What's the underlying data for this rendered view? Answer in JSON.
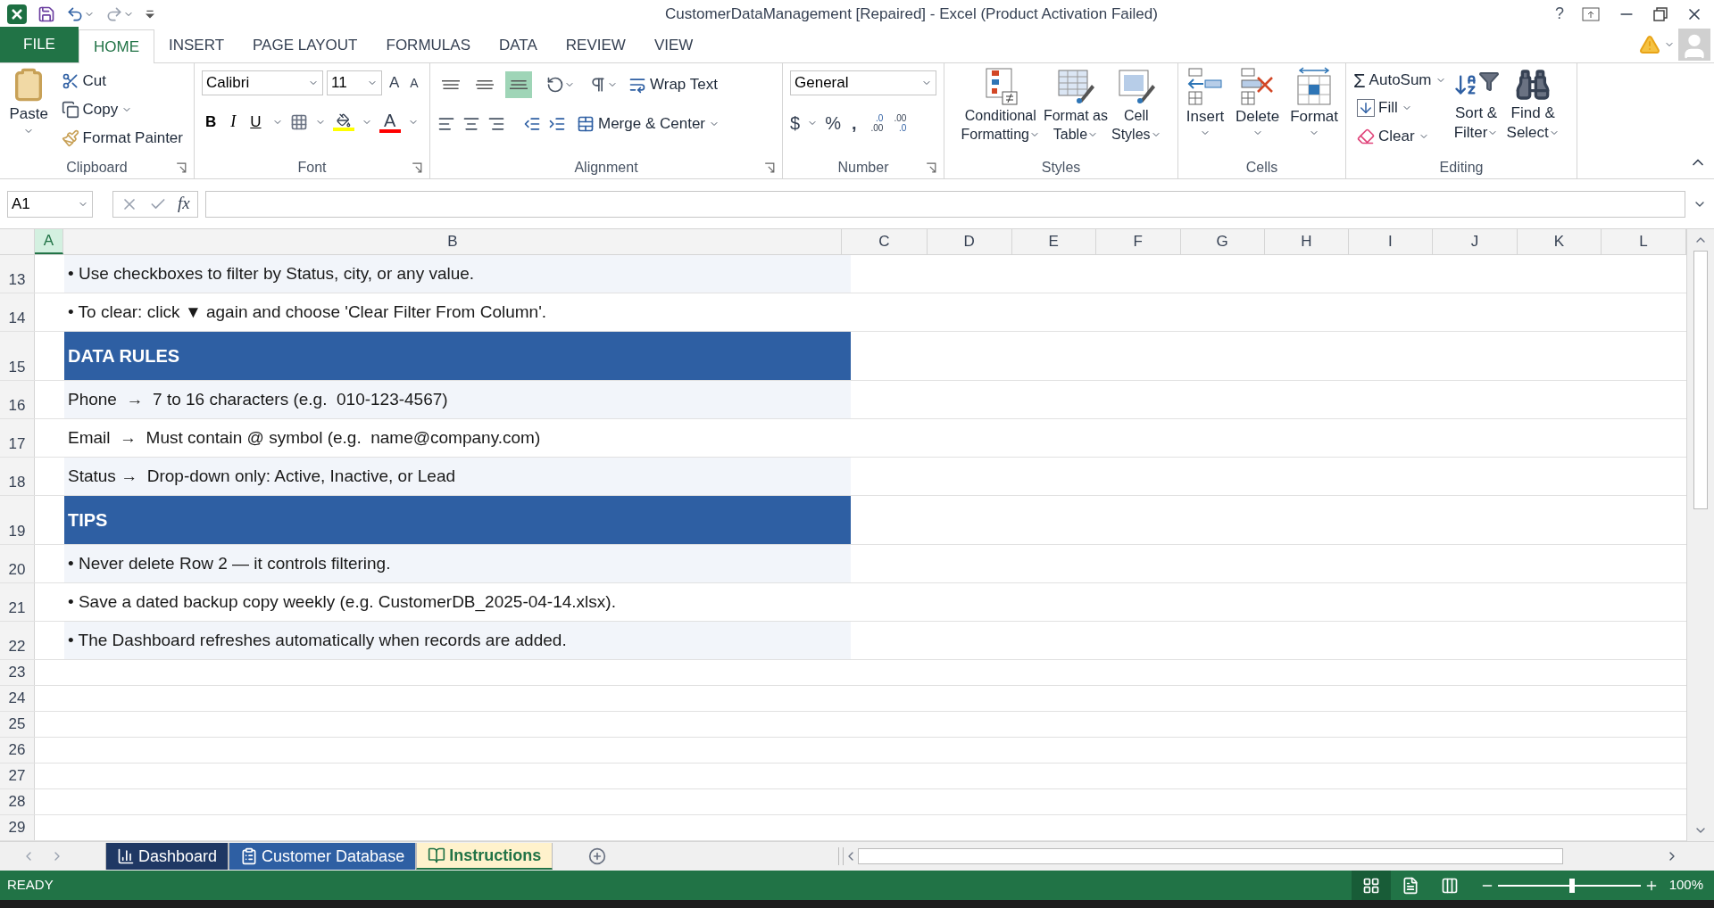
{
  "window": {
    "title": "CustomerDataManagement [Repaired] - Excel (Product Activation Failed)",
    "help": "?"
  },
  "ribbon_tabs": [
    {
      "label": "FILE",
      "kind": "file",
      "selected": false
    },
    {
      "label": "HOME",
      "kind": "tab",
      "selected": true
    },
    {
      "label": "INSERT",
      "kind": "tab",
      "selected": false
    },
    {
      "label": "PAGE LAYOUT",
      "kind": "tab",
      "selected": false
    },
    {
      "label": "FORMULAS",
      "kind": "tab",
      "selected": false
    },
    {
      "label": "DATA",
      "kind": "tab",
      "selected": false
    },
    {
      "label": "REVIEW",
      "kind": "tab",
      "selected": false
    },
    {
      "label": "VIEW",
      "kind": "tab",
      "selected": false
    }
  ],
  "clipboard": {
    "label": "Clipboard",
    "paste": "Paste",
    "cut": "Cut",
    "copy": "Copy",
    "format_painter": "Format Painter"
  },
  "font": {
    "label": "Font",
    "name": "Calibri",
    "size": "11",
    "grow": "A",
    "shrink": "A",
    "bold": "B",
    "italic": "I",
    "underline": "U",
    "font_color": "A"
  },
  "alignment": {
    "label": "Alignment",
    "wrap_text": "Wrap Text",
    "merge_center": "Merge & Center",
    "vertical": [
      {
        "kind": "top",
        "selected": false
      },
      {
        "kind": "middle",
        "selected": false
      },
      {
        "kind": "bottom",
        "selected": true
      }
    ]
  },
  "number": {
    "label": "Number",
    "format": "General",
    "currency": "$",
    "percent": "%",
    "comma": ",",
    "increase_decimal": [
      ".0",
      ".00"
    ],
    "decrease_decimal": [
      ".00",
      ".0"
    ]
  },
  "styles": {
    "label": "Styles",
    "buttons": [
      {
        "kind": "conditional",
        "lines": [
          "Conditional",
          "Formatting"
        ]
      },
      {
        "kind": "table",
        "lines": [
          "Format as",
          "Table"
        ]
      },
      {
        "kind": "cell",
        "lines": [
          "Cell",
          "Styles"
        ]
      }
    ]
  },
  "cells": {
    "label": "Cells",
    "buttons": [
      {
        "kind": "insert",
        "label": "Insert"
      },
      {
        "kind": "delete",
        "label": "Delete"
      },
      {
        "kind": "format",
        "label": "Format"
      }
    ]
  },
  "editing": {
    "label": "Editing",
    "autosum_glyph": "Σ",
    "autosum": "AutoSum",
    "fill": "Fill",
    "clear": "Clear",
    "sort_filter": [
      "Sort &",
      "Filter"
    ],
    "find_select": [
      "Find &",
      "Select"
    ]
  },
  "formula_bar": {
    "name_box": "A1",
    "fx": "fx"
  },
  "columns": [
    {
      "label": "A",
      "selected": true
    },
    {
      "label": "B",
      "selected": false
    },
    {
      "label": "C",
      "selected": false
    },
    {
      "label": "D",
      "selected": false
    },
    {
      "label": "E",
      "selected": false
    },
    {
      "label": "F",
      "selected": false
    },
    {
      "label": "G",
      "selected": false
    },
    {
      "label": "H",
      "selected": false
    },
    {
      "label": "I",
      "selected": false
    },
    {
      "label": "J",
      "selected": false
    },
    {
      "label": "K",
      "selected": false
    },
    {
      "label": "L",
      "selected": false
    }
  ],
  "rows": [
    {
      "number": "13",
      "kind": "text",
      "shaded": true,
      "text": "• Use checkboxes to filter by Status, city, or any value."
    },
    {
      "number": "14",
      "kind": "text",
      "shaded": false,
      "text": "• To clear: click ▼ again and choose 'Clear Filter From Column'."
    },
    {
      "number": "15",
      "kind": "section",
      "text": "DATA RULES"
    },
    {
      "number": "16",
      "kind": "text",
      "shaded": true,
      "text": "Phone  →  7 to 16 characters (e.g.  010-123-4567)"
    },
    {
      "number": "17",
      "kind": "text",
      "shaded": false,
      "text": "Email  →  Must contain @ symbol (e.g.  name@company.com)"
    },
    {
      "number": "18",
      "kind": "text",
      "shaded": true,
      "text": "Status →  Drop-down only: Active, Inactive, or Lead"
    },
    {
      "number": "19",
      "kind": "section",
      "text": "TIPS"
    },
    {
      "number": "20",
      "kind": "text",
      "shaded": true,
      "text": "• Never delete Row 2 — it controls filtering."
    },
    {
      "number": "21",
      "kind": "text",
      "shaded": false,
      "text": "• Save a dated backup copy weekly (e.g. CustomerDB_2025-04-14.xlsx)."
    },
    {
      "number": "22",
      "kind": "text",
      "shaded": true,
      "text": "• The Dashboard refreshes automatically when records are added."
    },
    {
      "number": "23",
      "kind": "empty"
    },
    {
      "number": "24",
      "kind": "empty"
    },
    {
      "number": "25",
      "kind": "empty"
    },
    {
      "number": "26",
      "kind": "empty"
    },
    {
      "number": "27",
      "kind": "empty"
    },
    {
      "number": "28",
      "kind": "empty"
    },
    {
      "number": "29",
      "kind": "empty"
    }
  ],
  "sheet_tabs": [
    {
      "label": "Dashboard",
      "kind": "chart",
      "color": "#1f3864",
      "selected": false
    },
    {
      "label": "Customer Database",
      "kind": "clipboard",
      "color": "#2e5fa3",
      "selected": false
    },
    {
      "label": "Instructions",
      "kind": "book",
      "color": "#fff2cc",
      "selected": true
    }
  ],
  "status_bar": {
    "status": "READY",
    "views": [
      {
        "kind": "normal",
        "selected": true
      },
      {
        "kind": "page_layout",
        "selected": false
      },
      {
        "kind": "page_break",
        "selected": false
      }
    ],
    "zoom": {
      "level": 0.52,
      "reading": "100%"
    }
  }
}
